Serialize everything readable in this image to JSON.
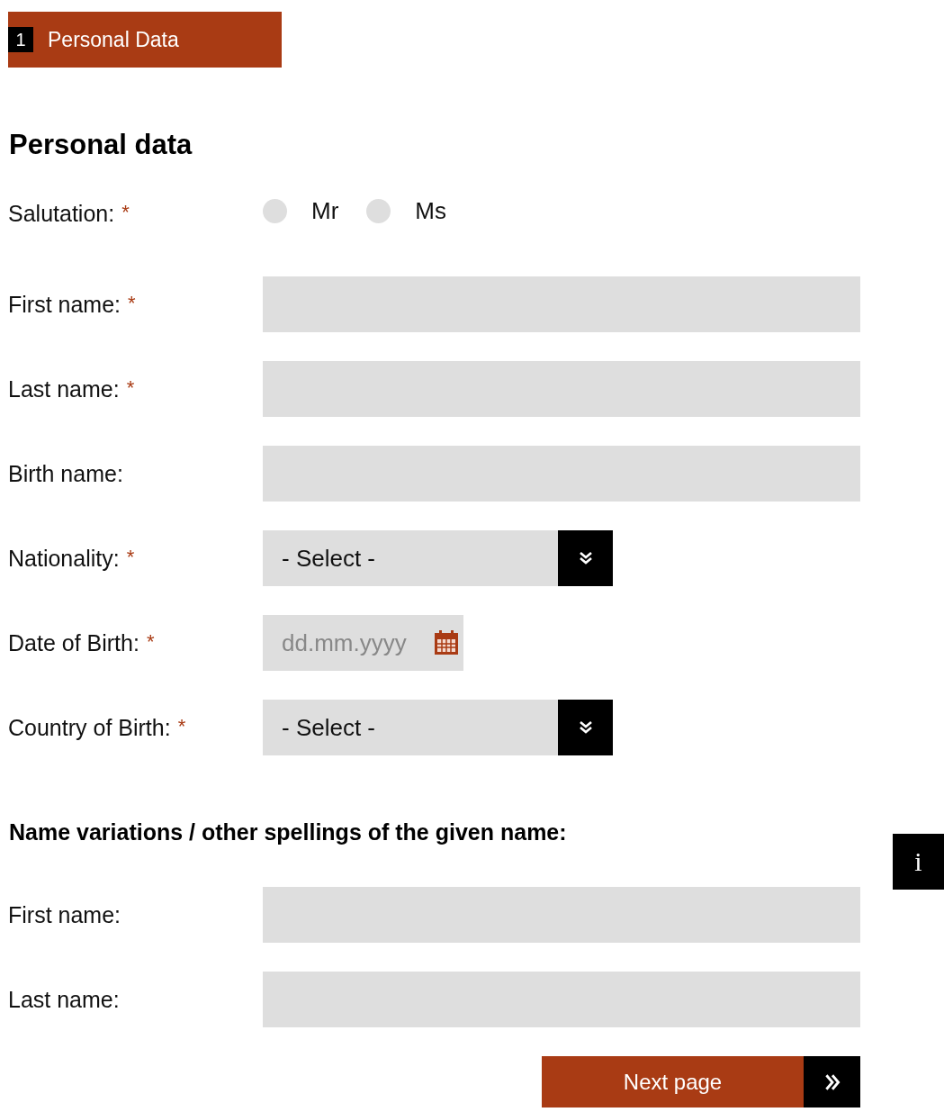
{
  "step": {
    "number": "1",
    "label": "Personal Data",
    "selected": true
  },
  "heading": "Personal data",
  "fields": [
    {
      "kind": "radio",
      "label": "Salutation:",
      "required_mark": "*",
      "options": [
        {
          "label": "Mr",
          "selected": false
        },
        {
          "label": "Ms",
          "selected": false
        }
      ]
    },
    {
      "kind": "text",
      "label": "First name:",
      "required_mark": "*"
    },
    {
      "kind": "text",
      "label": "Last name:",
      "required_mark": "*"
    },
    {
      "kind": "text",
      "label": "Birth name:"
    },
    {
      "kind": "select",
      "label": "Nationality:",
      "required_mark": "*",
      "value": "- Select -"
    },
    {
      "kind": "date",
      "label": "Date of Birth:",
      "required_mark": "*",
      "placeholder": "dd.mm.yyyy"
    },
    {
      "kind": "select",
      "label": "Country of Birth:",
      "required_mark": "*",
      "value": "- Select -"
    }
  ],
  "variations": {
    "heading": "Name variations / other spellings of the given name:",
    "fields": [
      {
        "kind": "text",
        "label": "First name:"
      },
      {
        "kind": "text",
        "label": "Last name:"
      }
    ]
  },
  "info_button": "i",
  "next_button": "Next page"
}
